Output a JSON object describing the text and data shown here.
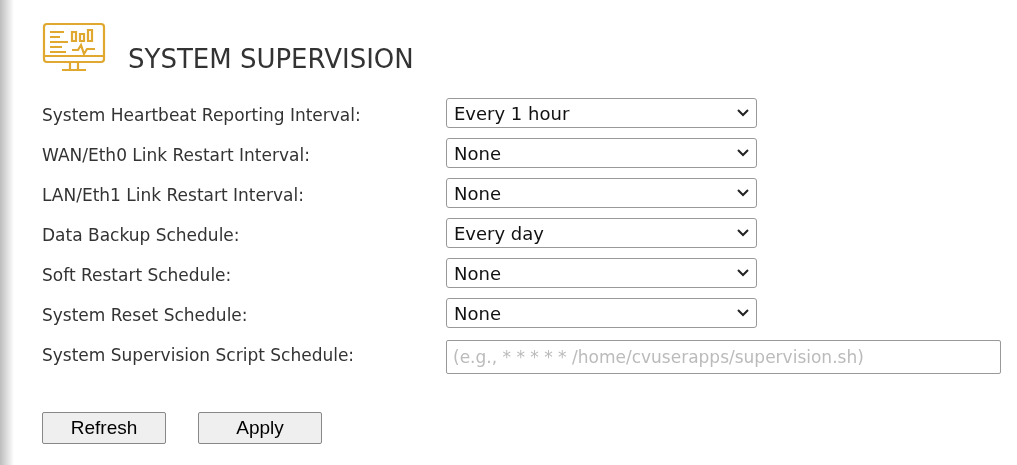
{
  "title": "SYSTEM SUPERVISION",
  "fields": [
    {
      "kind": "select",
      "label": "System Heartbeat Reporting Interval:",
      "value": "Every 1 hour"
    },
    {
      "kind": "select",
      "label": "WAN/Eth0 Link Restart Interval:",
      "value": "None"
    },
    {
      "kind": "select",
      "label": "LAN/Eth1 Link Restart Interval:",
      "value": "None"
    },
    {
      "kind": "select",
      "label": "Data Backup Schedule:",
      "value": "Every day"
    },
    {
      "kind": "select",
      "label": "Soft Restart Schedule:",
      "value": "None"
    },
    {
      "kind": "select",
      "label": "System Reset Schedule:",
      "value": "None"
    },
    {
      "kind": "text",
      "label": "System Supervision Script Schedule:",
      "placeholder": "(e.g., * * * * * /home/cvuserapps/supervision.sh)"
    }
  ],
  "buttons": [
    "Refresh",
    "Apply"
  ]
}
